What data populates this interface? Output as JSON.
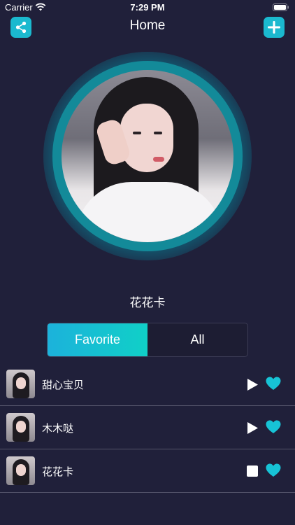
{
  "status_bar": {
    "carrier": "Carrier",
    "time": "7:29 PM"
  },
  "nav": {
    "title": "Home",
    "left_icon": "share-icon",
    "right_icon": "plus-icon"
  },
  "profile": {
    "name": "花花卡"
  },
  "tabs": [
    {
      "label": "Favorite",
      "active": true
    },
    {
      "label": "All",
      "active": false
    }
  ],
  "songs": [
    {
      "title": "甜心宝贝",
      "control": "play",
      "favorite": true
    },
    {
      "title": "木木哒",
      "control": "play",
      "favorite": true
    },
    {
      "title": "花花卡",
      "control": "stop",
      "favorite": true
    }
  ],
  "colors": {
    "accent": "#1bb9cf",
    "background": "#20203a",
    "gradient_start": "#1cb2db",
    "gradient_end": "#10d0c7"
  }
}
